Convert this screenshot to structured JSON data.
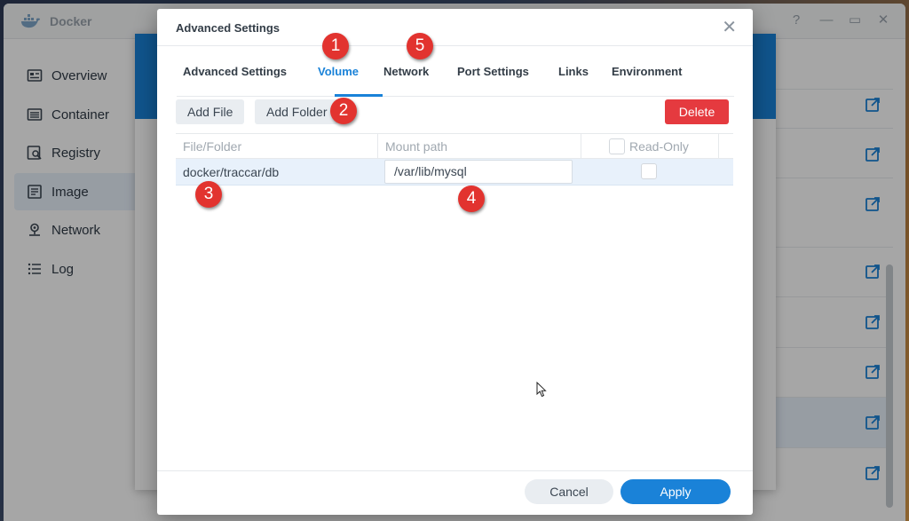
{
  "app": {
    "title": "Docker"
  },
  "window_controls": {
    "help": "?",
    "minimize": "—",
    "maximize": "▭",
    "close": "✕"
  },
  "sidebar": {
    "items": [
      {
        "label": "Overview",
        "icon": "overview-icon"
      },
      {
        "label": "Container",
        "icon": "container-icon"
      },
      {
        "label": "Registry",
        "icon": "registry-icon"
      },
      {
        "label": "Image",
        "icon": "image-icon",
        "active": true
      },
      {
        "label": "Network",
        "icon": "network-icon"
      },
      {
        "label": "Log",
        "icon": "log-icon"
      }
    ]
  },
  "dialog": {
    "title": "Advanced Settings",
    "close": "✕",
    "tabs": [
      {
        "label": "Advanced Settings"
      },
      {
        "label": "Volume",
        "active": true
      },
      {
        "label": "Network"
      },
      {
        "label": "Port Settings"
      },
      {
        "label": "Links"
      },
      {
        "label": "Environment"
      }
    ],
    "toolbar": {
      "add_file": "Add File",
      "add_folder": "Add Folder",
      "delete": "Delete"
    },
    "columns": {
      "file_folder": "File/Folder",
      "mount_path": "Mount path",
      "read_only": "Read-Only"
    },
    "rows": [
      {
        "file_folder": "docker/traccar/db",
        "mount_path": "/var/lib/mysql",
        "read_only": false
      }
    ],
    "footer": {
      "cancel": "Cancel",
      "apply": "Apply"
    }
  },
  "annotations": [
    "1",
    "2",
    "3",
    "4",
    "5"
  ],
  "colors": {
    "accent": "#1a82d8",
    "danger": "#e53a3f",
    "marker": "#e2332f",
    "selection": "#e8f1fb"
  }
}
